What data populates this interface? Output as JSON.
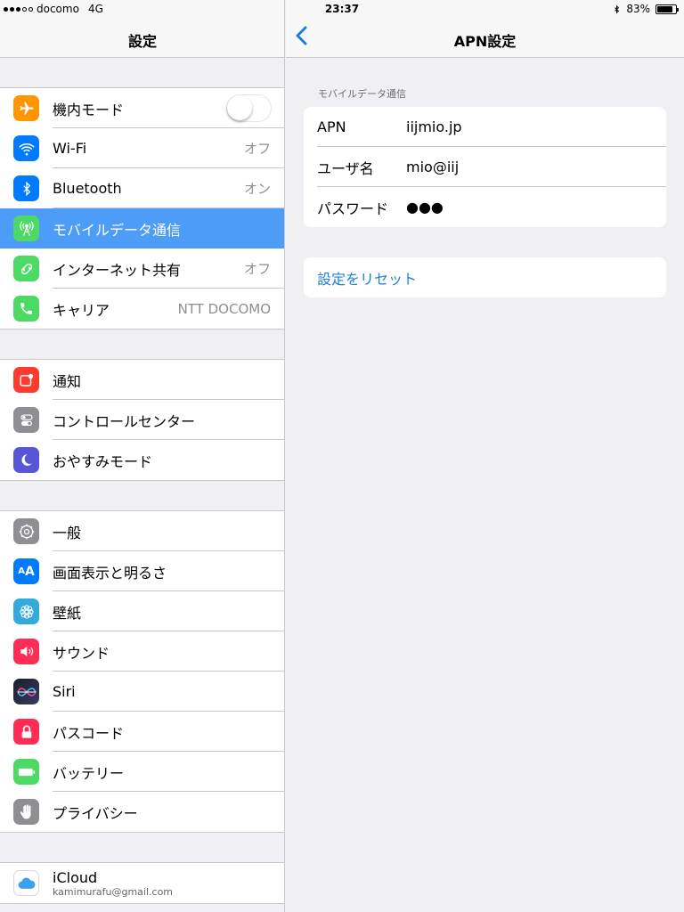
{
  "status_bar": {
    "carrier": "docomo",
    "network": "4G",
    "time": "23:37",
    "battery": "83%",
    "battery_level": 0.83
  },
  "left_panel": {
    "title": "設定",
    "groups": [
      {
        "items": [
          {
            "label": "機内モード",
            "icon": "airplane-icon",
            "icon_color": "#ff9500",
            "toggle": false
          },
          {
            "label": "Wi-Fi",
            "value": "オフ",
            "icon": "wifi-icon",
            "icon_color": "#007aff"
          },
          {
            "label": "Bluetooth",
            "value": "オン",
            "icon": "bluetooth-icon",
            "icon_color": "#007aff"
          },
          {
            "label": "モバイルデータ通信",
            "icon": "cellular-icon",
            "icon_color": "#4cd964",
            "selected": true
          },
          {
            "label": "インターネット共有",
            "value": "オフ",
            "icon": "hotspot-icon",
            "icon_color": "#4cd964"
          },
          {
            "label": "キャリア",
            "value": "NTT DOCOMO",
            "icon": "phone-icon",
            "icon_color": "#4cd964"
          }
        ]
      },
      {
        "items": [
          {
            "label": "通知",
            "icon": "notifications-icon",
            "icon_color": "#ff3b30"
          },
          {
            "label": "コントロールセンター",
            "icon": "control-center-icon",
            "icon_color": "#8e8e93"
          },
          {
            "label": "おやすみモード",
            "icon": "moon-icon",
            "icon_color": "#5856d6"
          }
        ]
      },
      {
        "items": [
          {
            "label": "一般",
            "icon": "gear-icon",
            "icon_color": "#8e8e93"
          },
          {
            "label": "画面表示と明るさ",
            "icon": "display-icon",
            "icon_color": "#007aff"
          },
          {
            "label": "壁紙",
            "icon": "wallpaper-icon",
            "icon_color": "#34aadc"
          },
          {
            "label": "サウンド",
            "icon": "sound-icon",
            "icon_color": "#ff2d55"
          },
          {
            "label": "Siri",
            "icon": "siri-icon",
            "icon_color": "#1c1c2e"
          },
          {
            "label": "パスコード",
            "icon": "lock-icon",
            "icon_color": "#ff2d55"
          },
          {
            "label": "バッテリー",
            "icon": "battery-icon",
            "icon_color": "#4cd964"
          },
          {
            "label": "プライバシー",
            "icon": "hand-icon",
            "icon_color": "#8e8e93"
          }
        ]
      },
      {
        "items": [
          {
            "label": "iCloud",
            "sublabel": "kamimurafu@gmail.com",
            "icon": "icloud-icon",
            "icon_color": "#ffffff"
          }
        ]
      }
    ]
  },
  "right_panel": {
    "title": "APN設定",
    "section_header": "モバイルデータ通信",
    "fields": [
      {
        "label": "APN",
        "value": "iijmio.jp"
      },
      {
        "label": "ユーザ名",
        "value": "mio@iij"
      },
      {
        "label": "パスワード",
        "value": "●●●"
      }
    ],
    "reset_label": "設定をリセット"
  }
}
